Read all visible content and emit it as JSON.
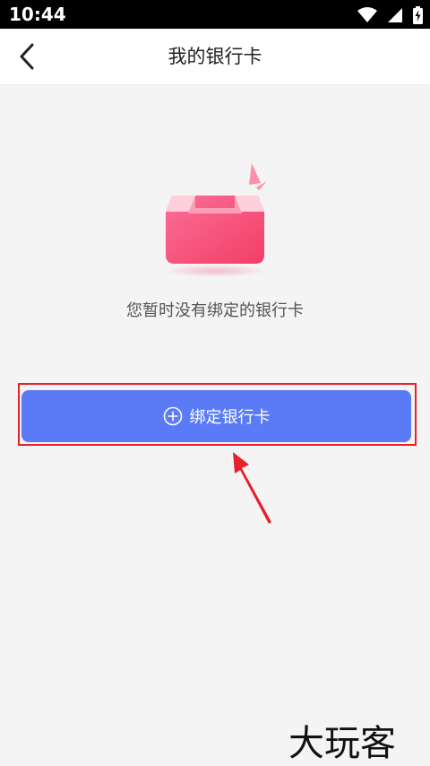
{
  "status_bar": {
    "time": "10:44",
    "icons": [
      "wifi-icon",
      "cell-signal-icon",
      "battery-charging-icon"
    ]
  },
  "header": {
    "title": "我的银行卡",
    "back_icon": "chevron-left-icon"
  },
  "empty_state": {
    "illustration": "empty-box-illustration",
    "message": "您暂时没有绑定的银行卡"
  },
  "action": {
    "bind_label": "绑定银行卡",
    "icon": "plus-circle-icon"
  },
  "annotation": {
    "highlight_color": "#e8202a",
    "arrow_color": "#e8202a"
  },
  "watermark": {
    "text": "大玩客"
  },
  "colors": {
    "primary": "#5a7bf5",
    "illustration": "#f7527c",
    "background": "#f4f4f4"
  }
}
